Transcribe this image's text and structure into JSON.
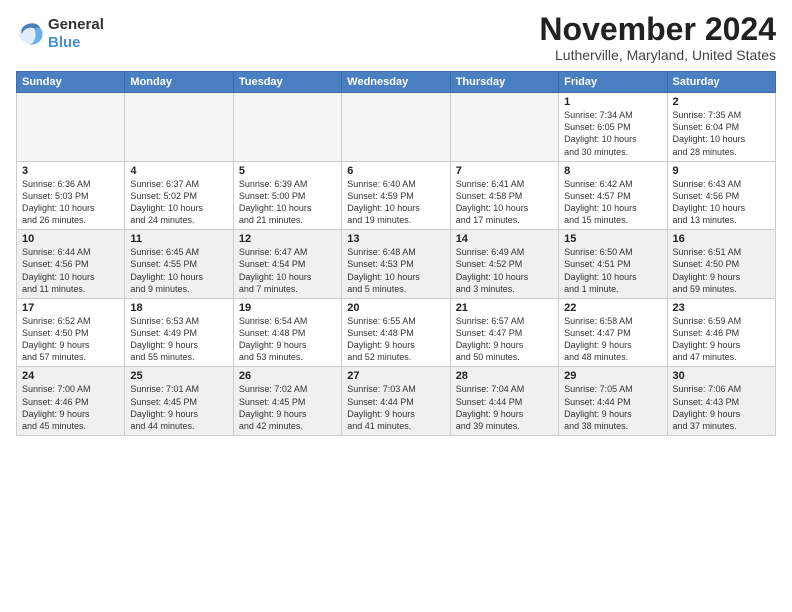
{
  "logo": {
    "general": "General",
    "blue": "Blue"
  },
  "header": {
    "month": "November 2024",
    "location": "Lutherville, Maryland, United States"
  },
  "weekdays": [
    "Sunday",
    "Monday",
    "Tuesday",
    "Wednesday",
    "Thursday",
    "Friday",
    "Saturday"
  ],
  "rows": [
    [
      {
        "day": "",
        "info": "",
        "empty": true
      },
      {
        "day": "",
        "info": "",
        "empty": true
      },
      {
        "day": "",
        "info": "",
        "empty": true
      },
      {
        "day": "",
        "info": "",
        "empty": true
      },
      {
        "day": "",
        "info": "",
        "empty": true
      },
      {
        "day": "1",
        "info": "Sunrise: 7:34 AM\nSunset: 6:05 PM\nDaylight: 10 hours\nand 30 minutes.",
        "empty": false
      },
      {
        "day": "2",
        "info": "Sunrise: 7:35 AM\nSunset: 6:04 PM\nDaylight: 10 hours\nand 28 minutes.",
        "empty": false
      }
    ],
    [
      {
        "day": "3",
        "info": "Sunrise: 6:36 AM\nSunset: 5:03 PM\nDaylight: 10 hours\nand 26 minutes.",
        "empty": false
      },
      {
        "day": "4",
        "info": "Sunrise: 6:37 AM\nSunset: 5:02 PM\nDaylight: 10 hours\nand 24 minutes.",
        "empty": false
      },
      {
        "day": "5",
        "info": "Sunrise: 6:39 AM\nSunset: 5:00 PM\nDaylight: 10 hours\nand 21 minutes.",
        "empty": false
      },
      {
        "day": "6",
        "info": "Sunrise: 6:40 AM\nSunset: 4:59 PM\nDaylight: 10 hours\nand 19 minutes.",
        "empty": false
      },
      {
        "day": "7",
        "info": "Sunrise: 6:41 AM\nSunset: 4:58 PM\nDaylight: 10 hours\nand 17 minutes.",
        "empty": false
      },
      {
        "day": "8",
        "info": "Sunrise: 6:42 AM\nSunset: 4:57 PM\nDaylight: 10 hours\nand 15 minutes.",
        "empty": false
      },
      {
        "day": "9",
        "info": "Sunrise: 6:43 AM\nSunset: 4:56 PM\nDaylight: 10 hours\nand 13 minutes.",
        "empty": false
      }
    ],
    [
      {
        "day": "10",
        "info": "Sunrise: 6:44 AM\nSunset: 4:56 PM\nDaylight: 10 hours\nand 11 minutes.",
        "empty": false
      },
      {
        "day": "11",
        "info": "Sunrise: 6:45 AM\nSunset: 4:55 PM\nDaylight: 10 hours\nand 9 minutes.",
        "empty": false
      },
      {
        "day": "12",
        "info": "Sunrise: 6:47 AM\nSunset: 4:54 PM\nDaylight: 10 hours\nand 7 minutes.",
        "empty": false
      },
      {
        "day": "13",
        "info": "Sunrise: 6:48 AM\nSunset: 4:53 PM\nDaylight: 10 hours\nand 5 minutes.",
        "empty": false
      },
      {
        "day": "14",
        "info": "Sunrise: 6:49 AM\nSunset: 4:52 PM\nDaylight: 10 hours\nand 3 minutes.",
        "empty": false
      },
      {
        "day": "15",
        "info": "Sunrise: 6:50 AM\nSunset: 4:51 PM\nDaylight: 10 hours\nand 1 minute.",
        "empty": false
      },
      {
        "day": "16",
        "info": "Sunrise: 6:51 AM\nSunset: 4:50 PM\nDaylight: 9 hours\nand 59 minutes.",
        "empty": false
      }
    ],
    [
      {
        "day": "17",
        "info": "Sunrise: 6:52 AM\nSunset: 4:50 PM\nDaylight: 9 hours\nand 57 minutes.",
        "empty": false
      },
      {
        "day": "18",
        "info": "Sunrise: 6:53 AM\nSunset: 4:49 PM\nDaylight: 9 hours\nand 55 minutes.",
        "empty": false
      },
      {
        "day": "19",
        "info": "Sunrise: 6:54 AM\nSunset: 4:48 PM\nDaylight: 9 hours\nand 53 minutes.",
        "empty": false
      },
      {
        "day": "20",
        "info": "Sunrise: 6:55 AM\nSunset: 4:48 PM\nDaylight: 9 hours\nand 52 minutes.",
        "empty": false
      },
      {
        "day": "21",
        "info": "Sunrise: 6:57 AM\nSunset: 4:47 PM\nDaylight: 9 hours\nand 50 minutes.",
        "empty": false
      },
      {
        "day": "22",
        "info": "Sunrise: 6:58 AM\nSunset: 4:47 PM\nDaylight: 9 hours\nand 48 minutes.",
        "empty": false
      },
      {
        "day": "23",
        "info": "Sunrise: 6:59 AM\nSunset: 4:46 PM\nDaylight: 9 hours\nand 47 minutes.",
        "empty": false
      }
    ],
    [
      {
        "day": "24",
        "info": "Sunrise: 7:00 AM\nSunset: 4:46 PM\nDaylight: 9 hours\nand 45 minutes.",
        "empty": false
      },
      {
        "day": "25",
        "info": "Sunrise: 7:01 AM\nSunset: 4:45 PM\nDaylight: 9 hours\nand 44 minutes.",
        "empty": false
      },
      {
        "day": "26",
        "info": "Sunrise: 7:02 AM\nSunset: 4:45 PM\nDaylight: 9 hours\nand 42 minutes.",
        "empty": false
      },
      {
        "day": "27",
        "info": "Sunrise: 7:03 AM\nSunset: 4:44 PM\nDaylight: 9 hours\nand 41 minutes.",
        "empty": false
      },
      {
        "day": "28",
        "info": "Sunrise: 7:04 AM\nSunset: 4:44 PM\nDaylight: 9 hours\nand 39 minutes.",
        "empty": false
      },
      {
        "day": "29",
        "info": "Sunrise: 7:05 AM\nSunset: 4:44 PM\nDaylight: 9 hours\nand 38 minutes.",
        "empty": false
      },
      {
        "day": "30",
        "info": "Sunrise: 7:06 AM\nSunset: 4:43 PM\nDaylight: 9 hours\nand 37 minutes.",
        "empty": false
      }
    ]
  ]
}
